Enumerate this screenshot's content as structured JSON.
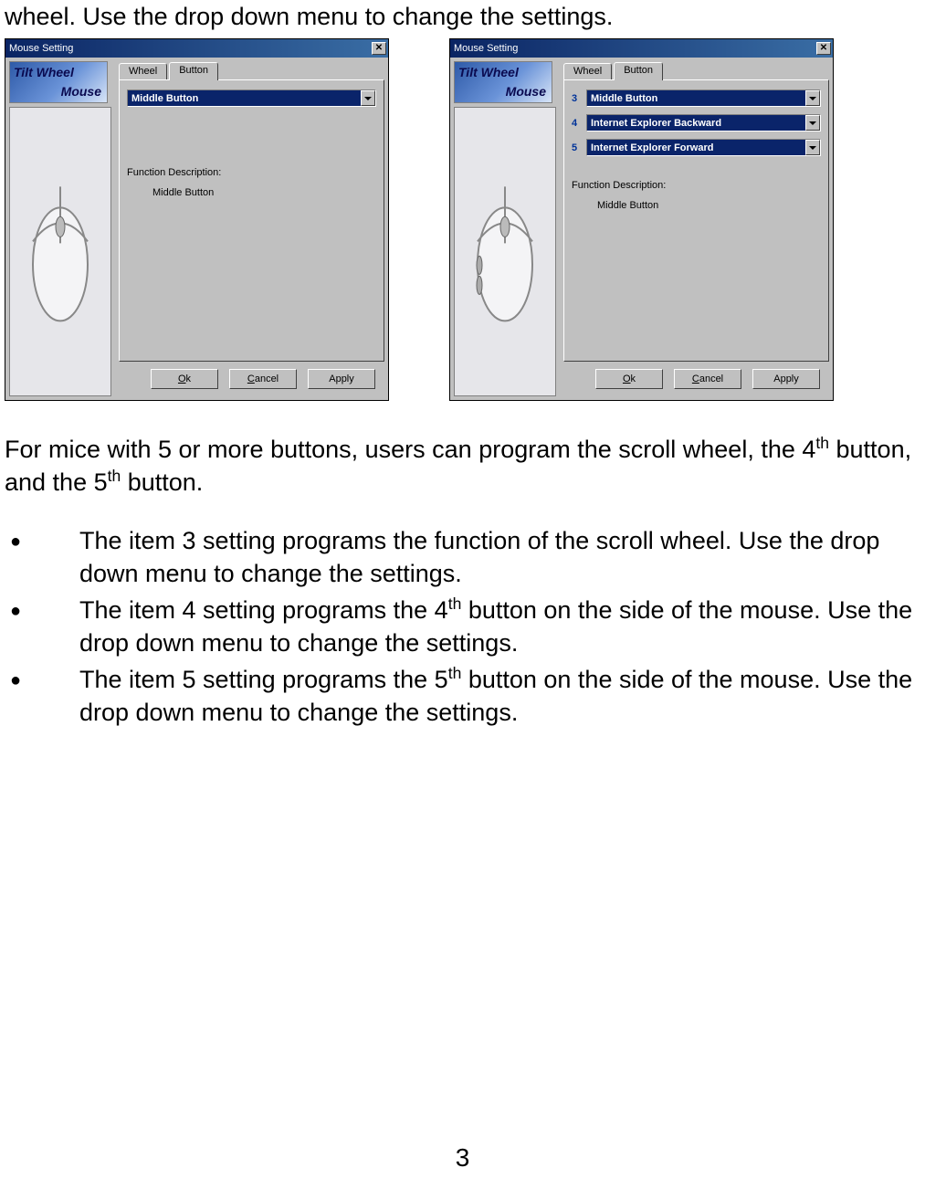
{
  "doc": {
    "intro_fragment": "wheel. Use the drop down menu to change the settings.",
    "para_before_sup1": "For mice with 5 or more buttons, users can program the scroll wheel, the 4",
    "para_between": " button, and the 5",
    "para_after": " button.",
    "th": "th",
    "bullets": [
      "The item 3 setting programs the function of the scroll wheel. Use the drop down menu to change the settings.",
      "The item 4 setting programs the 4th button on the side of the mouse. Use the drop down menu to change the settings.",
      "The item 5 setting programs the 5th button on the side of the mouse. Use the drop down menu to change the settings."
    ],
    "bullet2_pre": "The item 4 setting programs the 4",
    "bullet2_post": " button on the side of the mouse. Use the drop down menu to change the settings.",
    "bullet3_pre": "The item 5 setting programs the 5",
    "bullet3_post": " button on the side of the mouse. Use the drop down menu to change the settings.",
    "page_number": "3"
  },
  "dialog_left": {
    "title": "Mouse Setting",
    "brand_l1": "Tilt Wheel",
    "brand_l2": "Mouse",
    "tabs": {
      "wheel": "Wheel",
      "button": "Button"
    },
    "dropdown1": "Middle Button",
    "func_label": "Function Description:",
    "func_value": "Middle Button",
    "buttons": {
      "ok": "Ok",
      "cancel": "Cancel",
      "apply": "Apply"
    }
  },
  "dialog_right": {
    "title": "Mouse Setting",
    "brand_l1": "Tilt Wheel",
    "brand_l2": "Mouse",
    "tabs": {
      "wheel": "Wheel",
      "button": "Button"
    },
    "num3": "3",
    "dropdown3": "Middle Button",
    "num4": "4",
    "dropdown4": "Internet Explorer Backward",
    "num5": "5",
    "dropdown5": "Internet Explorer Forward",
    "func_label": "Function Description:",
    "func_value": "Middle Button",
    "buttons": {
      "ok": "Ok",
      "cancel": "Cancel",
      "apply": "Apply"
    }
  }
}
